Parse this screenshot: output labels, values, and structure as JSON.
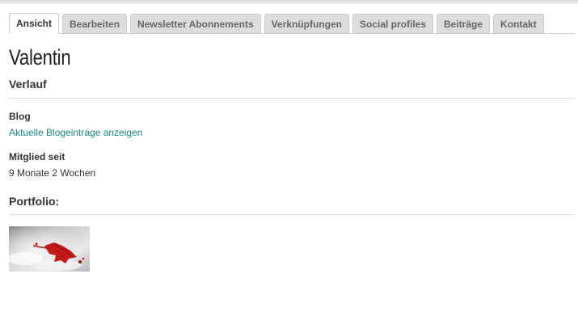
{
  "tabs": [
    {
      "label": "Ansicht",
      "active": true
    },
    {
      "label": "Bearbeiten",
      "active": false
    },
    {
      "label": "Newsletter Abonnements",
      "active": false
    },
    {
      "label": "Verknüpfungen",
      "active": false
    },
    {
      "label": "Social profiles",
      "active": false
    },
    {
      "label": "Beiträge",
      "active": false
    },
    {
      "label": "Kontakt",
      "active": false
    }
  ],
  "profile": {
    "name": "Valentin"
  },
  "history": {
    "title": "Verlauf",
    "blog_label": "Blog",
    "blog_link": "Aktuelle Blogeinträge anzeigen",
    "member_label": "Mitglied seit",
    "member_value": "9 Monate 2 Wochen"
  },
  "portfolio": {
    "title": "Portfolio:",
    "thumbnail_icon": "red-leaf-in-snow-image"
  },
  "colors": {
    "link": "#1a8a8a",
    "tab_bg": "#dddddd",
    "tab_active_bg": "#ffffff"
  }
}
